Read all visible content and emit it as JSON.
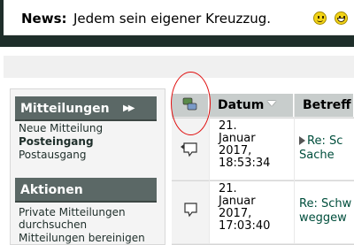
{
  "news": {
    "label": "News:",
    "text": "Jedem sein eigener Kreuzzug."
  },
  "sidebar": {
    "sections": [
      {
        "title": "Mitteilungen",
        "items": [
          {
            "label": "Neue Mitteilung",
            "active": false
          },
          {
            "label": "Posteingang",
            "active": true
          },
          {
            "label": "Postausgang",
            "active": false
          }
        ]
      },
      {
        "title": "Aktionen",
        "items": [
          {
            "label": "Private Mitteilungen durchsuchen",
            "active": false
          },
          {
            "label": "Mitteilungen bereinigen",
            "active": false
          }
        ]
      }
    ]
  },
  "table": {
    "columns": [
      "Datum",
      "Betreff"
    ],
    "rows": [
      {
        "date_lines": [
          "21.",
          "Januar",
          "2017,",
          "18:53:34"
        ],
        "subject_lines": [
          "Re: Sc",
          "Sache"
        ],
        "replied": true
      },
      {
        "date_lines": [
          "21.",
          "Januar",
          "2017,",
          "17:03:40"
        ],
        "subject_lines": [
          "Re: Schw",
          "weggew"
        ],
        "replied": false
      }
    ]
  },
  "colors": {
    "header_bg": "#1e2e2a",
    "section_header": "#5b6866",
    "link": "#004e3c",
    "highlight": "#e01010"
  }
}
